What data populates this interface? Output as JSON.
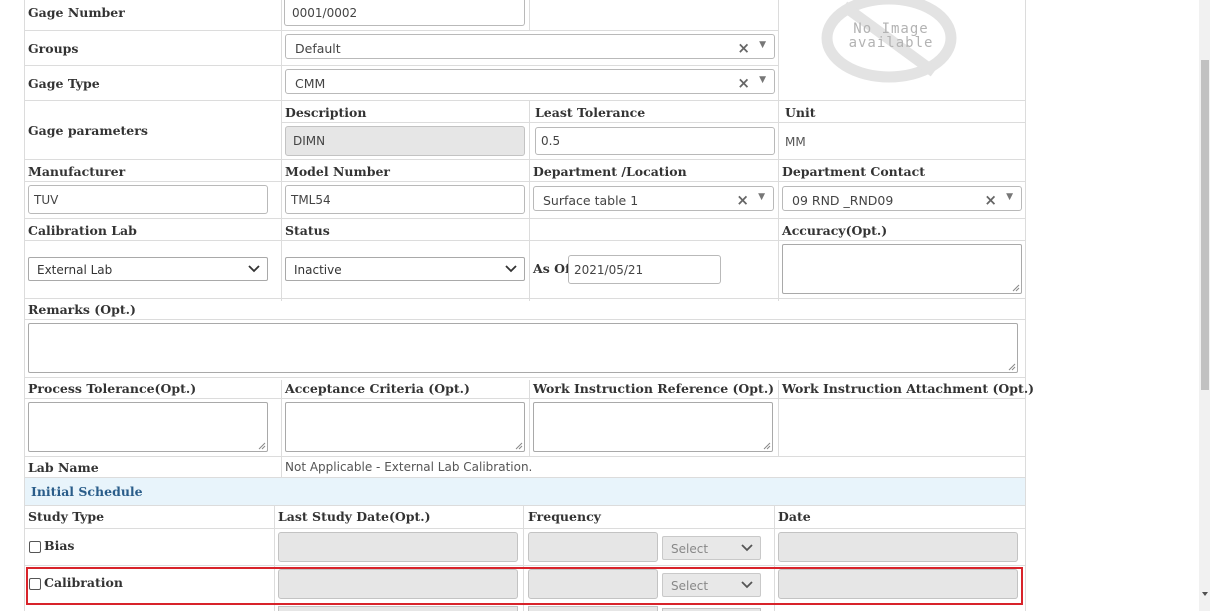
{
  "gage_number": {
    "label": "Gage Number",
    "value": "0001/0002"
  },
  "no_image": {
    "line1": "No Image",
    "line2": "available"
  },
  "groups": {
    "label": "Groups",
    "value": "Default"
  },
  "gage_type": {
    "label": "Gage Type",
    "value": "CMM"
  },
  "gage_parameters": {
    "label": "Gage parameters",
    "description_label": "Description",
    "description_value": "DIMN",
    "least_tolerance_label": "Least Tolerance",
    "least_tolerance_value": "0.5",
    "unit_label": "Unit",
    "unit_value": "MM"
  },
  "manufacturer": {
    "label": "Manufacturer",
    "value": "TUV"
  },
  "model_number": {
    "label": "Model Number",
    "value": "TML54"
  },
  "department_location": {
    "label": "Department /Location",
    "value": "Surface table 1"
  },
  "department_contact": {
    "label": "Department Contact",
    "value": "09 RND _RND09"
  },
  "calibration_lab": {
    "label": "Calibration Lab",
    "value": "External Lab"
  },
  "status": {
    "label": "Status",
    "value": "Inactive",
    "as_of_label": "As Of",
    "as_of_value": "2021/05/21"
  },
  "accuracy": {
    "label": "Accuracy(Opt.)"
  },
  "remarks": {
    "label": "Remarks (Opt.)"
  },
  "process_tolerance": {
    "label": "Process Tolerance(Opt.)"
  },
  "acceptance_criteria": {
    "label": "Acceptance Criteria (Opt.)"
  },
  "work_instruction_reference": {
    "label": "Work Instruction Reference (Opt.)"
  },
  "work_instruction_attachment": {
    "label": "Work Instruction Attachment (Opt.)"
  },
  "lab_name": {
    "label": "Lab Name",
    "value": "Not Applicable - External Lab Calibration."
  },
  "initial_schedule": {
    "title": "Initial Schedule",
    "columns": [
      "Study Type",
      "Last Study Date(Opt.)",
      "Frequency",
      "Date"
    ],
    "rows": [
      {
        "study_type": "Bias",
        "select_placeholder": "Select"
      },
      {
        "study_type": "Calibration",
        "select_placeholder": "Select"
      }
    ]
  },
  "icons": {
    "clear": "×",
    "dropdown": "▼"
  },
  "colors": {
    "section_header_bg": "#e8f4fb",
    "section_header_text": "#2a5d8a",
    "highlight_border": "#d8232a"
  }
}
